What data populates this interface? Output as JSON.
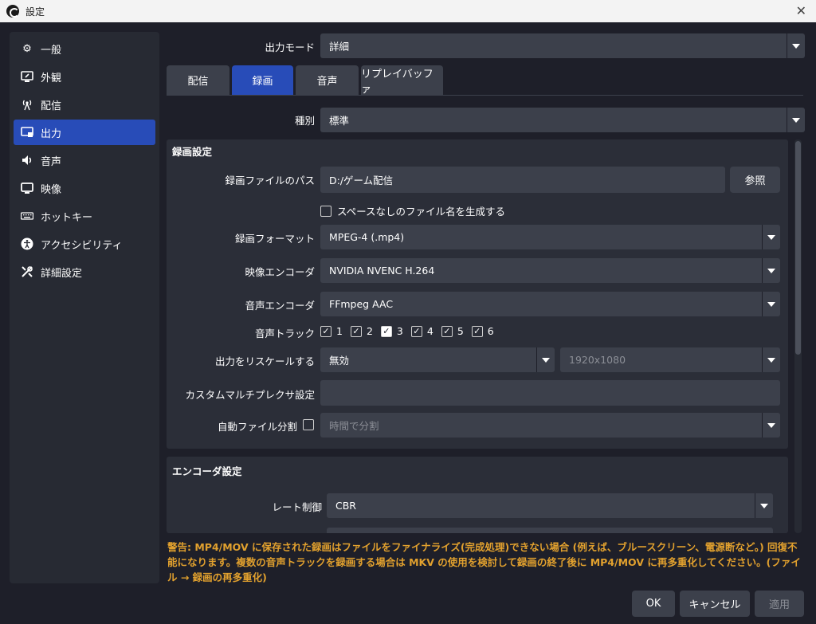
{
  "window": {
    "title": "設定"
  },
  "sidebar": {
    "items": [
      {
        "label": "一般",
        "icon": "gear-icon"
      },
      {
        "label": "外観",
        "icon": "appearance-icon"
      },
      {
        "label": "配信",
        "icon": "broadcast-icon"
      },
      {
        "label": "出力",
        "icon": "output-icon",
        "active": true
      },
      {
        "label": "音声",
        "icon": "speaker-icon"
      },
      {
        "label": "映像",
        "icon": "monitor-icon"
      },
      {
        "label": "ホットキー",
        "icon": "keyboard-icon"
      },
      {
        "label": "アクセシビリティ",
        "icon": "accessibility-icon"
      },
      {
        "label": "詳細設定",
        "icon": "tools-icon"
      }
    ]
  },
  "output_mode": {
    "label": "出力モード",
    "value": "詳細"
  },
  "tabs": [
    {
      "label": "配信"
    },
    {
      "label": "録画",
      "active": true
    },
    {
      "label": "音声"
    },
    {
      "label": "リプレイバッファ"
    }
  ],
  "type": {
    "label": "種別",
    "value": "標準"
  },
  "recording": {
    "section_title": "録画設定",
    "path_label": "録画ファイルのパス",
    "path_value": "D:/ゲーム配信",
    "browse_label": "参照",
    "nospace_label": "スペースなしのファイル名を生成する",
    "format_label": "録画フォーマット",
    "format_value": "MPEG-4 (.mp4)",
    "video_encoder_label": "映像エンコーダ",
    "video_encoder_value": "NVIDIA NVENC H.264",
    "audio_encoder_label": "音声エンコーダ",
    "audio_encoder_value": "FFmpeg AAC",
    "audio_track_label": "音声トラック",
    "tracks": [
      {
        "n": "1",
        "checked": true
      },
      {
        "n": "2",
        "checked": true
      },
      {
        "n": "3",
        "checked": true,
        "highlight": true
      },
      {
        "n": "4",
        "checked": true
      },
      {
        "n": "5",
        "checked": true
      },
      {
        "n": "6",
        "checked": true
      }
    ],
    "rescale_label": "出力をリスケールする",
    "rescale_value": "無効",
    "rescale_resolution": "1920x1080",
    "muxer_label": "カスタムマルチプレクサ設定",
    "muxer_value": "",
    "split_label": "自動ファイル分割",
    "split_value": "時間で分割"
  },
  "encoder": {
    "section_title": "エンコーダ設定",
    "rate_control_label": "レート制御",
    "rate_control_value": "CBR"
  },
  "warning": "警告: MP4/MOV に保存された録画はファイルをファイナライズ(完成処理)できない場合 (例えば、ブルースクリーン、電源断など。) 回復不能になります。複数の音声トラックを録画する場合は MKV の使用を検討して録画の終了後に MP4/MOV に再多重化してください。(ファイル → 録画の再多重化)",
  "buttons": {
    "ok": "OK",
    "cancel": "キャンセル",
    "apply": "適用"
  },
  "colors": {
    "accent": "#284cb8",
    "background": "#1e1f29",
    "panel": "#2b2e38",
    "field": "#3c404b",
    "warning": "#e2a12e"
  }
}
